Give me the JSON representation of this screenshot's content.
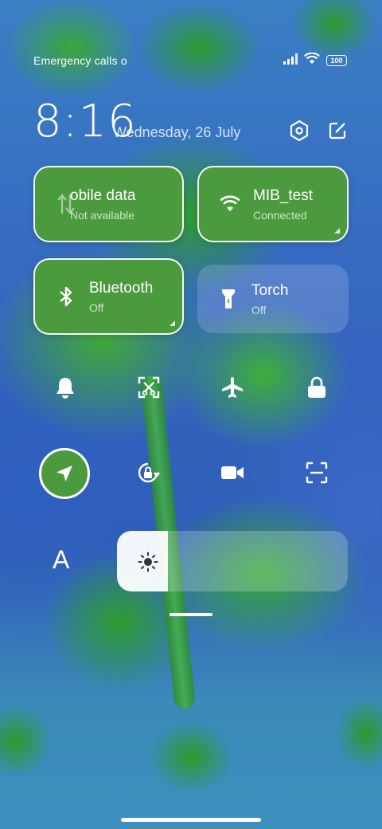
{
  "status_bar": {
    "text": "Emergency calls o",
    "icons": [
      "signal-icon",
      "wifi-icon",
      "battery-icon"
    ],
    "battery_level": "100"
  },
  "header": {
    "time": "8:16",
    "date": "Wednesday, 26 July",
    "icons": [
      "settings-icon",
      "edit-icon"
    ]
  },
  "tiles": [
    {
      "name": "obile data",
      "status": "Not available",
      "icon": "mobile-data-icon",
      "state": "on"
    },
    {
      "name": "MIB_test",
      "status": "Connected",
      "icon": "wifi-icon",
      "state": "on"
    },
    {
      "name": "Bluetooth",
      "status": "Off",
      "icon": "bluetooth-icon",
      "state": "on"
    },
    {
      "name": "Torch",
      "status": "Off",
      "icon": "torch-icon",
      "state": "off"
    }
  ],
  "quick_toggles_row1": [
    "bell-icon",
    "screenshot-icon",
    "airplane-icon",
    "lock-icon"
  ],
  "quick_toggles_row2": [
    "location-icon",
    "rotation-lock-icon",
    "video-icon",
    "scan-icon"
  ],
  "font_size_label": "A",
  "brightness": {
    "level": 0.22,
    "icon": "sun-icon"
  },
  "colors": {
    "tile_active": "#4c9a3e",
    "accent": "#ffffff"
  }
}
